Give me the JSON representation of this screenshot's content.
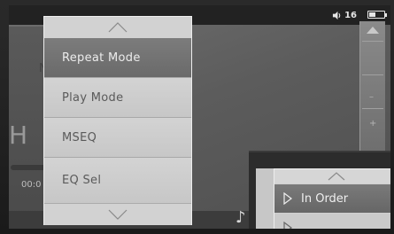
{
  "status": {
    "volume_level": "16",
    "icons": {
      "volume": "speaker-icon",
      "battery": "battery-icon"
    }
  },
  "background": {
    "track_letter": "N",
    "large_letter": "H",
    "time": "00:0",
    "icons": {
      "bottom_left": "bird-icon",
      "bottom_note": "music-note-icon"
    }
  },
  "menu": {
    "scroll_up_icon": "chevron-up-icon",
    "scroll_down_icon": "chevron-down-icon",
    "items": [
      {
        "label": "Repeat Mode",
        "selected": true
      },
      {
        "label": "Play Mode",
        "selected": false
      },
      {
        "label": "MSEQ",
        "selected": false
      },
      {
        "label": "EQ Sel",
        "selected": false
      }
    ]
  },
  "submenu": {
    "scroll_up_icon": "chevron-up-icon",
    "items": [
      {
        "label": "In Order",
        "selected": true,
        "icon": "play-triangle-icon"
      },
      {
        "label": "",
        "selected": false,
        "icon": "play-triangle-icon"
      }
    ]
  },
  "colors": {
    "menu_bg": "#c9c9c9",
    "menu_selected": "#6f6f6f",
    "menu_text": "#5a5a5a",
    "selected_text": "#ececec",
    "screen_bg": "#5c5c5c"
  }
}
